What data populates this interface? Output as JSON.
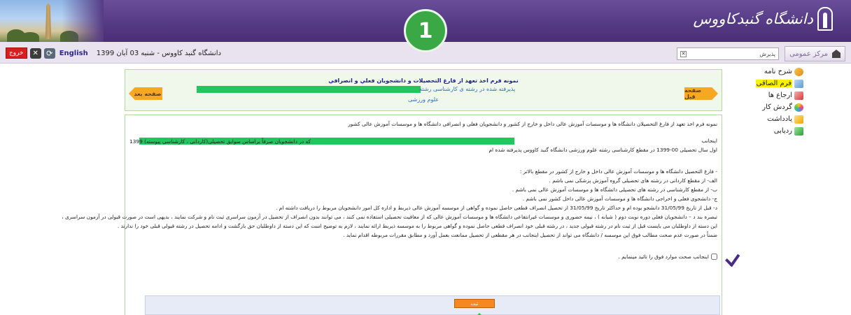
{
  "header": {
    "logo_text": "دانشگاه گنبدکاووس",
    "step_number": "1"
  },
  "infobar": {
    "exit_label": "خروج",
    "english_label": "English",
    "date_text": "دانشگاه گنبد کاووس - شنبه 03 آبان 1399",
    "user_name": "پذیرش",
    "center_tab_label": "مرکز عمومی"
  },
  "sidebar": {
    "items": [
      {
        "label": "شرح نامه"
      },
      {
        "label": "فرم الصاقی"
      },
      {
        "label": "ارجاع ها"
      },
      {
        "label": "گردش کار"
      },
      {
        "label": "یادداشت"
      },
      {
        "label": "ردیابی"
      }
    ]
  },
  "panel": {
    "prev_label": "صفحه قبل",
    "next_label": "صفحه بعد",
    "title": "نمونه فرم اخذ تعهد از فارغ التحصیلات و دانشجویان فعلي و انصرافي",
    "accepted_text": "پذیرفته شده در رشته ی کارشناسی رشته",
    "major_text": "علوم ورزشی"
  },
  "body": {
    "heading": "نمونه فرم اخذ تعهد از فارغ التحصیلان دانشگاه ها و موسسات آموزش عالی داخل و خارج از کشور و دانشجویان فعلی و انصرافی دانشگاه ها و موسسات آموزش عالی کشور",
    "line_intro_right": "اینجانب",
    "line_intro_left": "که در دانشجویان صرفاً براساس سوابق تحصیلی(کاردانی ، کارشناسی پیوسته) 1399",
    "line_intro2": "اول سال تحصیلی 00-1399 در مقطع کارشناسی رشته علوم ورزشی دانشگاه گنبد کاووس پذیرفته شده ام",
    "clauses": [
      "- فارغ التحصیل دانشگاه ها و موسسات آموزش عالی داخل و خارج از کشور در مقطع بالاتر :",
      "الف- از مقطع کاردانی در رشته های تحصیلی گروه آموزش پزشکی نمی باشم .",
      "ب- از مقطع کارشناسی در رشته های تحصیلی دانشگاه ها و موسسات آموزش عالی نمی باشم .",
      "ج- دانشجوی فعلی و اخراجی دانشگاه ها و موسسات آموزش عالی داخل کشور نمی باشم .",
      "د- قبل از تاریخ 31/05/99 دانشجو بوده ام و حداکثر تاریخ 31/05/99 از تحصیل انصراف قطعی حاصل نموده و گواهی از موسسه آموزش عالی ذیربط و اداره کل امور دانشجویان مربوط را دریافت داشته ام .",
      "تبصره بند د – دانشجویان فعلی دوره نوبت دوم ( شبانه ) ، نیمه حضوری و موسسات غیرانتفاعی دانشگاه ها و موسسات آموزش عالی که از معافیت تحصیلی استفاده نمی کنند ، می توانند بدون انصراف از تحصیل در آزمون سراسری ثبت نام و شرکت نمایند ، بدیهی است در صورت قبولی در آزمون سراسری ،",
      "این دسته از داوطلبان می بایست قبل از ثبت نام در رشته قبولی جدید ، در رشته قبلی خود انصراف قطعی حاصل نموده و گواهی مربوط را به موسسه ذیربط ارائه نمایند ، لازم به توضیح است که این دسته از داوطلبان حق بازگشت و ادامه تحصیل در رشته قبولی قبلی خود را ندارند .",
      "ضمناً در صورت عدم صحت مطالب فوق این موسسه / دانشگاه می تواند از تحصیل اینجانب در هر مقطعی از تحصیل ممانعت بعمل آورد و مطابق مقررات مربوطه اقدام نماید ."
    ],
    "confirm_text": "اینجانب صحت موارد فوق را تائید مینمایم .",
    "submit_label": "ثبت"
  }
}
